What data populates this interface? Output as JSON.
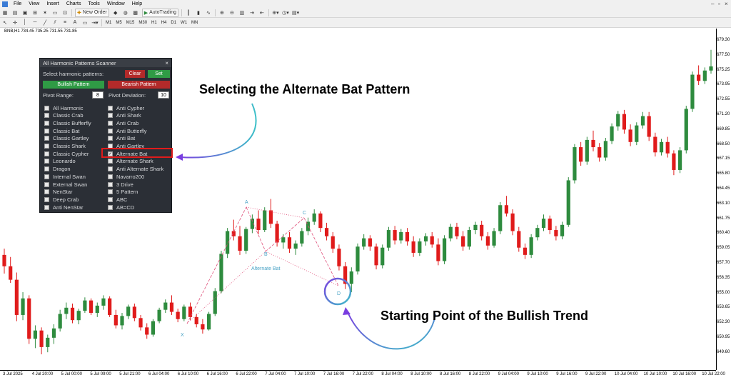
{
  "menu": {
    "items": [
      "File",
      "View",
      "Insert",
      "Charts",
      "Tools",
      "Window",
      "Help"
    ]
  },
  "toolbar": {
    "new_order": "New Order",
    "autotrading": "AutoTrading",
    "timeframes": [
      "M1",
      "M5",
      "M15",
      "M30",
      "H1",
      "H4",
      "D1",
      "W1",
      "MN"
    ]
  },
  "chart_info": "BNB,H1  734.45 735.25 731.55 731.85",
  "scanner": {
    "title": "All Harmonic Patterns Scanner",
    "select_label": "Select harmonic patterns:",
    "clear": "Clear",
    "set": "Set",
    "bullish": "Bullish Pattern",
    "bearish": "Bearish Pattern",
    "pivot_range_label": "Pivot Range:",
    "pivot_range_value": "8",
    "pivot_deviation_label": "Pivot Deviation:",
    "pivot_deviation_value": "10",
    "left_patterns": [
      "All Harmonic",
      "Classic Crab",
      "Classic Bufferfly",
      "Classic Bat",
      "Classic Gartley",
      "Classic Shark",
      "Classic Cypher",
      "Leonardo",
      "Dragon",
      "Internal Swan",
      "External Swan",
      "NenStar",
      "Deep Crab",
      "Anti NenStar"
    ],
    "right_patterns": [
      "Anti Cypher",
      "Anti Shark",
      "Anti Crab",
      "Anti Butterfly",
      "Anti Bat",
      "Anti Gartley",
      "Alternate Bat",
      "Alternate Shark",
      "Anti Alternate Shark",
      "Navarro200",
      "3 Drive",
      "5 Pattern",
      "ABC",
      "AB=CD"
    ],
    "checked": "Alternate Bat"
  },
  "annotations": {
    "alt_bat": "Selecting the Alternate Bat Pattern",
    "bullish_trend": "Starting Point of the Bullish Trend",
    "pattern_label": "Alternate Bat",
    "points": [
      "A",
      "B",
      "C",
      "D",
      "X"
    ]
  },
  "colors": {
    "bull": "#2e8b3e",
    "bear": "#e01b1b",
    "pattern": "#e0507a",
    "label": "#4aa3c6",
    "highlight": "#e01b1b",
    "arrow1": "#3cc0c8",
    "arrow2": "#7a3ee0"
  },
  "y_axis": [
    "679.30",
    "677.50",
    "675.25",
    "673.95",
    "672.55",
    "671.20",
    "669.85",
    "668.50",
    "667.15",
    "665.80",
    "664.45",
    "663.10",
    "661.75",
    "660.40",
    "659.05",
    "657.70",
    "656.35",
    "655.00",
    "653.65",
    "652.30",
    "650.95",
    "649.60"
  ],
  "x_axis": [
    "3 Jul 2025",
    "4 Jul 20:00",
    "5 Jul 00:00",
    "5 Jul 09:00",
    "5 Jul 21:00",
    "6 Jul 04:00",
    "6 Jul 10:00",
    "6 Jul 16:00",
    "6 Jul 22:00",
    "7 Jul 04:00",
    "7 Jul 10:00",
    "7 Jul 16:00",
    "7 Jul 22:00",
    "8 Jul 04:00",
    "8 Jul 10:00",
    "8 Jul 16:00",
    "8 Jul 22:00",
    "9 Jul 04:00",
    "9 Jul 10:00",
    "9 Jul 16:00",
    "9 Jul 22:00",
    "10 Jul 04:00",
    "10 Jul 10:00",
    "10 Jul 16:00",
    "10 Jul 22:00"
  ],
  "chart_data": {
    "type": "candlestick",
    "ylim": [
      648.5,
      680.5
    ],
    "candles": [
      [
        659.2,
        659.8,
        657.4,
        658.1
      ],
      [
        658.1,
        659.0,
        656.5,
        656.8
      ],
      [
        656.8,
        657.5,
        652.8,
        653.4
      ],
      [
        653.4,
        655.6,
        652.9,
        655.0
      ],
      [
        655.0,
        655.3,
        650.6,
        651.1
      ],
      [
        651.1,
        652.4,
        650.2,
        651.9
      ],
      [
        651.9,
        652.2,
        649.6,
        650.3
      ],
      [
        650.3,
        651.5,
        649.8,
        651.2
      ],
      [
        651.2,
        652.5,
        650.6,
        652.1
      ],
      [
        652.1,
        653.9,
        651.8,
        653.5
      ],
      [
        653.5,
        654.6,
        653.0,
        654.1
      ],
      [
        654.1,
        654.5,
        652.6,
        652.9
      ],
      [
        652.9,
        654.0,
        652.5,
        653.8
      ],
      [
        653.8,
        655.1,
        653.6,
        654.8
      ],
      [
        654.8,
        655.0,
        653.4,
        653.6
      ],
      [
        653.6,
        654.6,
        653.2,
        654.3
      ],
      [
        654.3,
        655.3,
        653.9,
        655.0
      ],
      [
        655.0,
        655.2,
        653.2,
        653.4
      ],
      [
        653.4,
        653.9,
        652.1,
        652.4
      ],
      [
        652.4,
        653.6,
        652.0,
        653.3
      ],
      [
        653.3,
        654.4,
        653.0,
        654.2
      ],
      [
        654.2,
        654.5,
        652.8,
        653.1
      ],
      [
        653.1,
        653.4,
        651.9,
        652.2
      ],
      [
        652.2,
        652.6,
        651.1,
        651.5
      ],
      [
        651.5,
        653.0,
        651.3,
        652.8
      ],
      [
        652.8,
        654.1,
        652.6,
        653.9
      ],
      [
        653.9,
        654.9,
        653.6,
        654.6
      ],
      [
        654.6,
        655.3,
        653.4,
        653.7
      ],
      [
        653.7,
        654.0,
        652.7,
        653.0
      ],
      [
        653.0,
        654.4,
        652.8,
        654.2
      ],
      [
        654.2,
        654.6,
        652.9,
        653.2
      ],
      [
        653.2,
        653.5,
        652.2,
        652.5
      ],
      [
        652.5,
        653.0,
        651.6,
        652.0
      ],
      [
        652.0,
        653.7,
        651.9,
        653.5
      ],
      [
        653.5,
        656.0,
        653.3,
        655.7
      ],
      [
        655.7,
        659.6,
        655.5,
        659.3
      ],
      [
        659.3,
        661.8,
        658.9,
        661.5
      ],
      [
        661.5,
        662.6,
        660.6,
        661.0
      ],
      [
        661.0,
        662.0,
        659.2,
        659.6
      ],
      [
        659.6,
        661.9,
        659.3,
        661.7
      ],
      [
        661.7,
        663.1,
        661.3,
        662.7
      ],
      [
        662.7,
        663.5,
        661.2,
        661.6
      ],
      [
        661.6,
        663.8,
        661.4,
        663.5
      ],
      [
        663.5,
        664.6,
        661.8,
        662.2
      ],
      [
        662.2,
        662.5,
        660.0,
        660.4
      ],
      [
        660.4,
        661.2,
        659.8,
        660.9
      ],
      [
        660.9,
        661.4,
        659.4,
        659.8
      ],
      [
        659.8,
        660.6,
        659.2,
        660.3
      ],
      [
        660.3,
        661.8,
        660.0,
        661.5
      ],
      [
        661.5,
        662.8,
        661.1,
        662.4
      ],
      [
        662.4,
        663.6,
        662.1,
        663.2
      ],
      [
        663.2,
        663.4,
        661.4,
        661.8
      ],
      [
        661.8,
        662.3,
        660.6,
        661.0
      ],
      [
        661.0,
        661.4,
        659.4,
        659.8
      ],
      [
        659.8,
        660.2,
        657.7,
        658.1
      ],
      [
        658.1,
        658.5,
        655.9,
        656.4
      ],
      [
        656.4,
        658.0,
        655.6,
        657.6
      ],
      [
        657.6,
        660.3,
        657.3,
        660.0
      ],
      [
        660.0,
        661.2,
        659.7,
        660.8
      ],
      [
        660.8,
        661.1,
        659.6,
        660.0
      ],
      [
        660.0,
        660.3,
        657.8,
        658.2
      ],
      [
        658.2,
        660.2,
        657.9,
        659.9
      ],
      [
        659.9,
        661.9,
        659.6,
        661.6
      ],
      [
        661.6,
        662.0,
        660.2,
        660.6
      ],
      [
        660.6,
        661.7,
        660.3,
        661.4
      ],
      [
        661.4,
        661.8,
        660.1,
        660.5
      ],
      [
        660.5,
        661.0,
        659.0,
        659.4
      ],
      [
        659.4,
        660.8,
        659.1,
        660.5
      ],
      [
        660.5,
        661.3,
        660.1,
        661.0
      ],
      [
        661.0,
        661.4,
        659.9,
        660.2
      ],
      [
        660.2,
        660.8,
        658.2,
        658.6
      ],
      [
        658.6,
        661.1,
        658.3,
        660.8
      ],
      [
        660.8,
        662.2,
        660.5,
        661.9
      ],
      [
        661.9,
        662.3,
        660.7,
        661.0
      ],
      [
        661.0,
        661.5,
        659.6,
        660.0
      ],
      [
        660.0,
        661.9,
        659.7,
        661.6
      ],
      [
        661.6,
        662.4,
        661.2,
        662.1
      ],
      [
        662.1,
        662.5,
        660.6,
        661.0
      ],
      [
        661.0,
        661.4,
        659.7,
        660.1
      ],
      [
        660.1,
        661.8,
        659.9,
        661.5
      ],
      [
        661.5,
        664.3,
        661.2,
        664.0
      ],
      [
        664.0,
        664.9,
        662.9,
        663.2
      ],
      [
        663.2,
        663.6,
        661.1,
        661.5
      ],
      [
        661.5,
        661.9,
        659.5,
        659.9
      ],
      [
        659.9,
        660.3,
        658.8,
        659.2
      ],
      [
        659.2,
        661.2,
        658.9,
        660.9
      ],
      [
        660.9,
        662.1,
        660.6,
        661.8
      ],
      [
        661.8,
        663.1,
        661.5,
        662.7
      ],
      [
        662.7,
        663.0,
        661.2,
        661.6
      ],
      [
        661.6,
        662.0,
        660.6,
        661.0
      ],
      [
        661.0,
        662.4,
        660.7,
        662.1
      ],
      [
        662.1,
        666.7,
        661.9,
        666.4
      ],
      [
        666.4,
        669.9,
        666.1,
        669.6
      ],
      [
        669.6,
        670.1,
        667.8,
        668.2
      ],
      [
        668.2,
        670.6,
        667.9,
        670.3
      ],
      [
        670.3,
        671.2,
        669.2,
        669.6
      ],
      [
        669.6,
        670.0,
        668.2,
        668.6
      ],
      [
        668.6,
        670.5,
        668.3,
        670.2
      ],
      [
        670.2,
        671.9,
        669.9,
        671.6
      ],
      [
        671.6,
        673.1,
        671.2,
        672.8
      ],
      [
        672.8,
        673.2,
        670.9,
        671.3
      ],
      [
        671.3,
        671.8,
        669.7,
        670.1
      ],
      [
        670.1,
        672.0,
        669.8,
        671.7
      ],
      [
        671.7,
        673.0,
        671.4,
        672.6
      ],
      [
        672.6,
        673.0,
        670.2,
        670.6
      ],
      [
        670.6,
        671.0,
        668.7,
        669.1
      ],
      [
        669.1,
        670.4,
        668.8,
        670.1
      ],
      [
        670.1,
        670.6,
        668.6,
        669.0
      ],
      [
        669.0,
        669.3,
        666.9,
        667.4
      ],
      [
        667.4,
        669.6,
        667.1,
        669.3
      ],
      [
        669.3,
        673.6,
        669.0,
        673.3
      ],
      [
        673.3,
        676.9,
        673.0,
        676.6
      ],
      [
        676.6,
        677.5,
        675.6,
        676.0
      ],
      [
        676.0,
        677.3,
        675.7,
        677.0
      ],
      [
        677.0,
        679.0,
        676.7,
        677.4
      ]
    ]
  }
}
